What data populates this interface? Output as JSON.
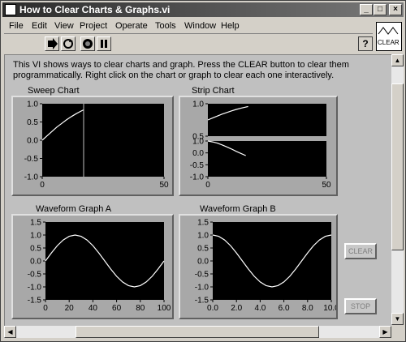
{
  "window": {
    "title": "How to Clear Charts & Graphs.vi",
    "controls": [
      "_",
      "□",
      "×"
    ]
  },
  "menu": [
    {
      "label": "File"
    },
    {
      "label": "Edit"
    },
    {
      "label": "View"
    },
    {
      "label": "Project"
    },
    {
      "label": "Operate"
    },
    {
      "label": "Tools"
    },
    {
      "label": "Window"
    },
    {
      "label": "Help"
    }
  ],
  "toolbar": {
    "icons": [
      "run-arrow-icon",
      "run-continuously-icon",
      "abort-icon",
      "pause-icon"
    ],
    "help_label": "?",
    "connector_label": "CLEAR"
  },
  "description": "This VI shows ways to clear charts and graph.  Press the CLEAR button to clear them programmatically.  Right click on the chart or graph to clear each one interactively.",
  "charts": {
    "sweep": {
      "label": "Sweep Chart",
      "yticks": [
        "1.0",
        "0.5",
        "0.0",
        "-0.5",
        "-1.0"
      ],
      "xticks": [
        "0",
        "50"
      ]
    },
    "strip": {
      "label": "Strip Chart",
      "yticks_top": [
        "1.0",
        "0.5"
      ],
      "yticks_bottom": [
        "1.0",
        "0.0",
        "-0.5",
        "-1.0"
      ],
      "xticks": [
        "0",
        "50"
      ]
    },
    "graph_a": {
      "label": "Waveform Graph A",
      "yticks": [
        "1.5",
        "1.0",
        "0.5",
        "0.0",
        "-0.5",
        "-1.0",
        "-1.5"
      ],
      "xticks": [
        "0",
        "20",
        "40",
        "60",
        "80",
        "100"
      ]
    },
    "graph_b": {
      "label": "Waveform Graph B",
      "yticks": [
        "1.5",
        "1.0",
        "0.5",
        "0.0",
        "-0.5",
        "-1.0",
        "-1.5"
      ],
      "xticks": [
        "0.0",
        "2.0",
        "4.0",
        "6.0",
        "8.0",
        "10.0"
      ]
    }
  },
  "buttons": {
    "clear": "CLEAR",
    "stop": "STOP"
  },
  "colors": {
    "plot_bg": "#000000",
    "trace": "#ffffff",
    "panel": "#c0c0c0",
    "frame": "#a8a8a8"
  },
  "chart_data": [
    {
      "type": "line",
      "title": "Sweep Chart",
      "ylim": [
        -1.0,
        1.0
      ],
      "xlim": [
        0,
        50
      ],
      "series": [
        {
          "x": [
            0,
            2,
            4,
            6,
            8,
            10,
            12,
            14,
            16,
            17
          ],
          "values": [
            0.0,
            0.12,
            0.24,
            0.36,
            0.46,
            0.56,
            0.65,
            0.73,
            0.8,
            0.83
          ]
        }
      ],
      "sweep_line_x": 17
    },
    {
      "type": "line",
      "title": "Strip Chart",
      "xlim": [
        0,
        50
      ],
      "series": [
        {
          "x": [
            0,
            2,
            4,
            6,
            8,
            10,
            12,
            14,
            17
          ],
          "values": [
            0.0,
            0.12,
            0.24,
            0.36,
            0.46,
            0.56,
            0.65,
            0.73,
            0.83
          ]
        },
        {
          "x": [
            0,
            2,
            4,
            6,
            8,
            10,
            12,
            14,
            16
          ],
          "values": [
            1.0,
            0.95,
            0.88,
            0.78,
            0.67,
            0.55,
            0.42,
            0.3,
            0.18
          ]
        }
      ]
    },
    {
      "type": "line",
      "title": "Waveform Graph A",
      "ylim": [
        -1.5,
        1.5
      ],
      "xlim": [
        0,
        100
      ],
      "series": [
        {
          "x": [
            0,
            5,
            10,
            15,
            20,
            25,
            30,
            35,
            40,
            45,
            50,
            55,
            60,
            65,
            70,
            75,
            80,
            85,
            90,
            95,
            100
          ],
          "values": [
            0.0,
            0.31,
            0.59,
            0.81,
            0.95,
            1.0,
            0.95,
            0.81,
            0.59,
            0.31,
            0.0,
            -0.31,
            -0.59,
            -0.81,
            -0.95,
            -1.0,
            -0.95,
            -0.81,
            -0.59,
            -0.31,
            0.0
          ]
        }
      ]
    },
    {
      "type": "line",
      "title": "Waveform Graph B",
      "ylim": [
        -1.5,
        1.5
      ],
      "xlim": [
        0,
        10
      ],
      "series": [
        {
          "x": [
            0.0,
            0.5,
            1.0,
            1.5,
            2.0,
            2.5,
            3.0,
            3.5,
            4.0,
            4.5,
            5.0,
            5.5,
            6.0,
            6.5,
            7.0,
            7.5,
            8.0,
            8.5,
            9.0,
            9.5,
            10.0
          ],
          "values": [
            1.0,
            0.95,
            0.81,
            0.59,
            0.31,
            0.0,
            -0.31,
            -0.59,
            -0.81,
            -0.95,
            -1.0,
            -0.95,
            -0.81,
            -0.59,
            -0.31,
            0.0,
            0.31,
            0.59,
            0.81,
            0.95,
            1.0
          ]
        }
      ]
    }
  ]
}
